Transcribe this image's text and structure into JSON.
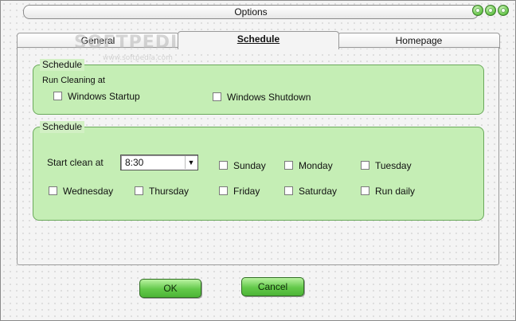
{
  "window": {
    "title": "Options"
  },
  "watermark": {
    "big": "SOFTPEDIA",
    "small": "www.softpedia.com"
  },
  "tabs": [
    {
      "label": "General"
    },
    {
      "label": "Schedule"
    },
    {
      "label": "Homepage"
    }
  ],
  "run_group": {
    "legend": "Schedule",
    "subtitle": "Run Cleaning at",
    "options": [
      {
        "label": "Windows Startup",
        "checked": false
      },
      {
        "label": "Windows Shutdown",
        "checked": false
      }
    ]
  },
  "days_group": {
    "legend": "Schedule",
    "start_label": "Start clean at",
    "start_time": "8:30",
    "days": [
      {
        "label": "Sunday",
        "checked": false
      },
      {
        "label": "Monday",
        "checked": false
      },
      {
        "label": "Tuesday",
        "checked": false
      },
      {
        "label": "Wednesday",
        "checked": false
      },
      {
        "label": "Thursday",
        "checked": false
      },
      {
        "label": "Friday",
        "checked": false
      },
      {
        "label": "Saturday",
        "checked": false
      },
      {
        "label": "Run daily",
        "checked": false
      }
    ]
  },
  "buttons": {
    "ok": "OK",
    "cancel": "Cancel"
  },
  "colors": {
    "group_fill": "#c5eeb5",
    "group_border": "#6aa95b",
    "button_green": "#63c94a",
    "title_button_green": "#6fcb52"
  }
}
